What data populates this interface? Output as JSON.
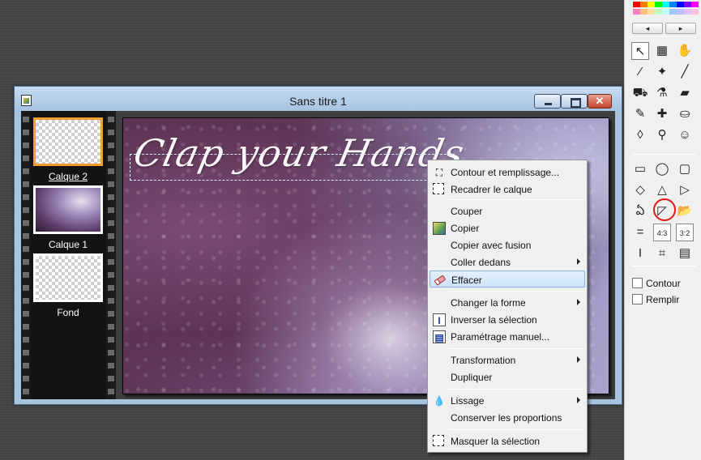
{
  "window": {
    "title": "Sans titre 1",
    "close_glyph": "✕"
  },
  "layers": [
    {
      "label": "Calque 2",
      "selected": true
    },
    {
      "label": "Calque 1",
      "selected": false
    },
    {
      "label": "Fond",
      "selected": false
    }
  ],
  "canvas": {
    "text": "Clap your Hands"
  },
  "context_menu": {
    "items": [
      {
        "label": "Contour et remplissage...",
        "icon": "paint-bucket-icon",
        "glyph": "⛶"
      },
      {
        "label": "Recadrer le calque",
        "icon": "crop-layer-icon",
        "glyph": ""
      },
      {
        "label": "Couper",
        "icon": "",
        "glyph": ""
      },
      {
        "label": "Copier",
        "icon": "copy-image-icon",
        "glyph": "▣"
      },
      {
        "label": "Copier avec fusion",
        "icon": "",
        "glyph": ""
      },
      {
        "label": "Coller dedans",
        "icon": "",
        "glyph": "",
        "submenu": true
      },
      {
        "label": "Effacer",
        "icon": "eraser-icon",
        "glyph": "",
        "highlighted": true
      },
      {
        "label": "Changer la forme",
        "icon": "",
        "glyph": "",
        "submenu": true
      },
      {
        "label": "Inverser la sélection",
        "icon": "invert-selection-icon",
        "glyph": "I"
      },
      {
        "label": "Paramétrage manuel...",
        "icon": "manual-settings-icon",
        "glyph": "▤"
      },
      {
        "label": "Transformation",
        "icon": "",
        "glyph": "",
        "submenu": true
      },
      {
        "label": "Dupliquer",
        "icon": "",
        "glyph": ""
      },
      {
        "label": "Lissage",
        "icon": "droplet-icon",
        "glyph": "💧",
        "submenu": true
      },
      {
        "label": "Conserver les proportions",
        "icon": "",
        "glyph": ""
      },
      {
        "label": "Masquer la sélection",
        "icon": "hide-selection-icon",
        "glyph": ""
      }
    ]
  },
  "toolbar": {
    "palette_colors": [
      "#ff0000",
      "#ff8000",
      "#ffff00",
      "#00ff00",
      "#00ffff",
      "#0080ff",
      "#0000ff",
      "#8000ff",
      "#ff00ff",
      "#ff80c0",
      "#ffc080",
      "#ffe0a0",
      "#c0ffc0",
      "#c0ffff",
      "#a0c8ff",
      "#c0c0ff",
      "#e0c0ff",
      "#ffc0e0"
    ],
    "prev_glyph": "◂",
    "next_glyph": "▸",
    "tools": [
      {
        "name": "pointer-tool-icon",
        "glyph": "↖",
        "selected": true
      },
      {
        "name": "window-tool-icon",
        "glyph": "▦"
      },
      {
        "name": "hand-tool-icon",
        "glyph": "✋"
      },
      {
        "name": "eyedropper-tool-icon",
        "glyph": "⁄"
      },
      {
        "name": "magic-wand-tool-icon",
        "glyph": "✦"
      },
      {
        "name": "line-tool-icon",
        "glyph": "╱"
      },
      {
        "name": "paint-bucket-tool-icon",
        "glyph": "⛟"
      },
      {
        "name": "spray-tool-icon",
        "glyph": "⚗"
      },
      {
        "name": "eraser-tool-icon",
        "glyph": "▰"
      },
      {
        "name": "brush-tool-icon",
        "glyph": "✎"
      },
      {
        "name": "clone-tool-icon",
        "glyph": "✚"
      },
      {
        "name": "stamp-tool-icon",
        "glyph": "⛀"
      },
      {
        "name": "smudge-tool-icon",
        "glyph": "◊"
      },
      {
        "name": "retouch-tool-icon",
        "glyph": "⚲"
      },
      {
        "name": "portrait-tool-icon",
        "glyph": "☺"
      },
      {
        "name": "rectangle-tool-icon",
        "glyph": "▭"
      },
      {
        "name": "ellipse-tool-icon",
        "glyph": "◯"
      },
      {
        "name": "rounded-rectangle-tool-icon",
        "glyph": "▢"
      },
      {
        "name": "diamond-tool-icon",
        "glyph": "◇"
      },
      {
        "name": "triangle-tool-icon",
        "glyph": "△"
      },
      {
        "name": "right-triangle-tool-icon",
        "glyph": "▷"
      },
      {
        "name": "lasso-tool-icon",
        "glyph": "ఏ"
      },
      {
        "name": "polygon-lasso-tool-icon",
        "glyph": "◸"
      },
      {
        "name": "open-folder-tool-icon",
        "glyph": "📂"
      },
      {
        "name": "equal-ratio-tool-icon",
        "glyph": "="
      },
      {
        "name": "ratio-4-3-tool-icon",
        "glyph": "4:3"
      },
      {
        "name": "ratio-3-2-tool-icon",
        "glyph": "3:2"
      },
      {
        "name": "text-selection-tool-icon",
        "glyph": "I"
      },
      {
        "name": "crop-handles-tool-icon",
        "glyph": "⌗"
      },
      {
        "name": "manual-settings-tool-icon",
        "glyph": "▤"
      }
    ],
    "contour_label": "Contour",
    "fill_label": "Remplir"
  }
}
